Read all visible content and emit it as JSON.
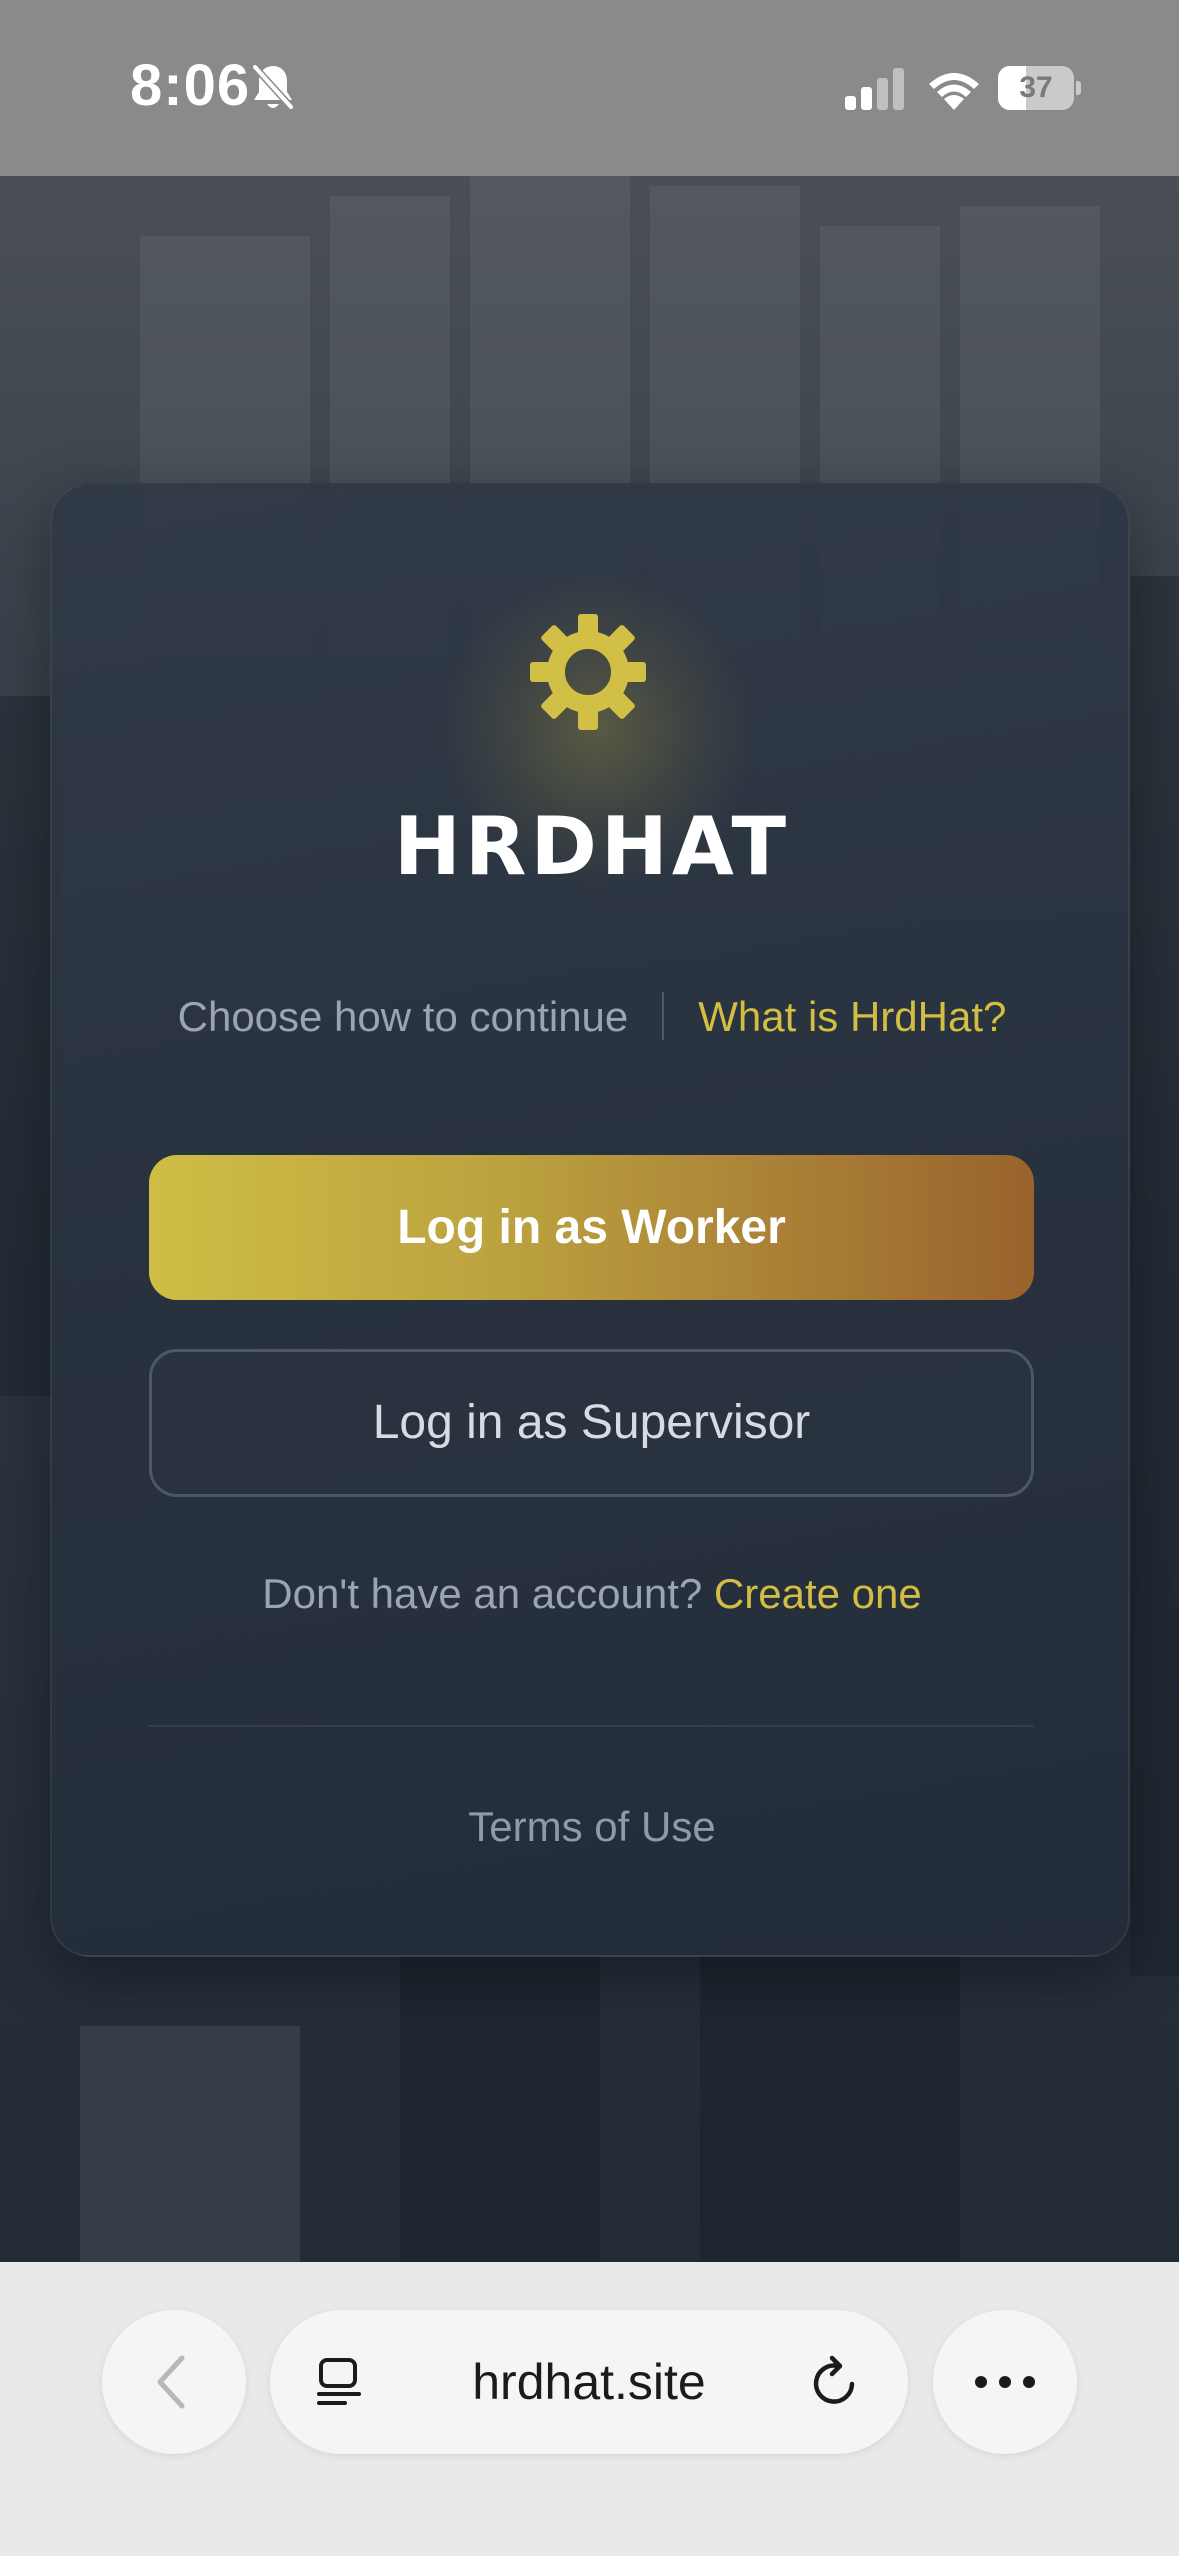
{
  "status_bar": {
    "time": "8:06",
    "battery": "37",
    "icons": [
      "bell-slash-icon",
      "cellular-signal-icon",
      "wifi-icon",
      "battery-icon"
    ]
  },
  "card": {
    "logo_text": "HRDHAT",
    "logo_icon": "gear-icon",
    "choose_text": "Choose how to continue",
    "what_link": "What is HrdHat?",
    "worker_button": "Log in as Worker",
    "supervisor_button": "Log in as Supervisor",
    "account_question": "Don't have an account?",
    "create_link": "Create one",
    "terms_link": "Terms of Use"
  },
  "browser": {
    "url": "hrdhat.site",
    "icons": [
      "back-chevron-icon",
      "tabs-icon",
      "reload-icon",
      "more-icon"
    ]
  },
  "colors": {
    "accent": "#d4bd43",
    "worker_gradient_start": "#cfbd45",
    "worker_gradient_end": "#98632c",
    "card_bg": "#2c3542",
    "muted_text": "#9aa4b4"
  }
}
